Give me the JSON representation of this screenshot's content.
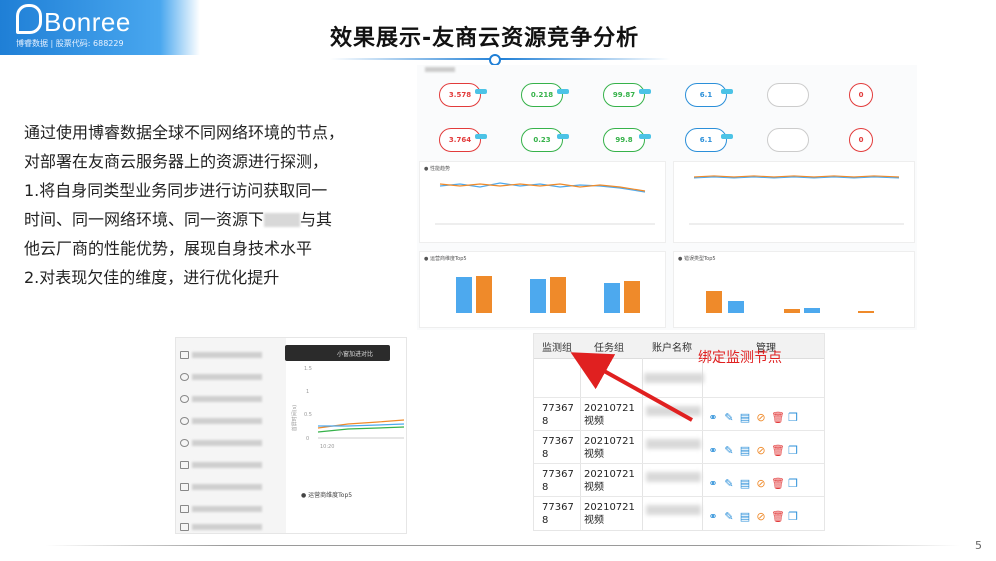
{
  "logo": {
    "brand": "Bonree",
    "subtitle": "博睿数据 | 股票代码: 688229"
  },
  "slide": {
    "title": "效果展示-友商云资源竞争分析",
    "page_number": "5",
    "description": {
      "line1": "通过使用博睿数据全球不同网络环境的节点，",
      "line2": "对部署在友商云服务器上的资源进行探测，",
      "line3": "1.将自身同类型业务同步进行访问获取同一",
      "line4a": "时间、同一网络环境、同一资源下",
      "line4b": "与其",
      "line5": "他云厂商的性能优势，展现自身技术水平",
      "line6": "2.对表现欠佳的维度，进行优化提升"
    }
  },
  "dashboard": {
    "row1": [
      {
        "value": "3.578",
        "color": "#e23b3b"
      },
      {
        "value": "0.218",
        "color": "#36b24a"
      },
      {
        "value": "99.87",
        "color": "#36b24a"
      },
      {
        "value": "6.1",
        "color": "#2b8fd9"
      }
    ],
    "row2": [
      {
        "value": "3.764",
        "color": "#e23b3b"
      },
      {
        "value": "0.23",
        "color": "#36b24a"
      },
      {
        "value": "99.8",
        "color": "#36b24a"
      },
      {
        "value": "6.1",
        "color": "#2b8fd9"
      }
    ],
    "extra_row1": "0",
    "extra_row2": "0",
    "panel_trend_title": "● 性能趋势",
    "panel_top_title": "● 运营商维度Top5",
    "panel_err_title": "● 错误类型Top5",
    "bar_labels": [
      "3.58",
      "3.64",
      "3.41",
      "3.58",
      "3.07",
      "3.22"
    ],
    "colors": {
      "blue": "#4da9ee",
      "orange": "#ef8a2a"
    }
  },
  "shot2": {
    "tooltip": "小窗加进对比",
    "panel_title": "● 运营商维度Top5",
    "y_ticks": [
      "1.5",
      "1",
      "0.5",
      "0"
    ],
    "x_tick": "10:20",
    "y_axis_label": "首屏时间(s)"
  },
  "table": {
    "headers": {
      "monitor_group": "监测组",
      "task_group": "任务组",
      "account": "账户名称",
      "manage": "管理"
    },
    "rows": [
      {
        "id": "77367 8",
        "task": "20210721视频"
      },
      {
        "id": "77367 8",
        "task": "20210721视频"
      },
      {
        "id": "77367 8",
        "task": "20210721视频"
      },
      {
        "id": "77367 8",
        "task": "20210721视频"
      }
    ],
    "annotation": "绑定监测节点",
    "action_icons": [
      "binoculars-icon",
      "edit-icon",
      "document-icon",
      "disable-icon",
      "delete-icon",
      "copy-icon"
    ]
  }
}
